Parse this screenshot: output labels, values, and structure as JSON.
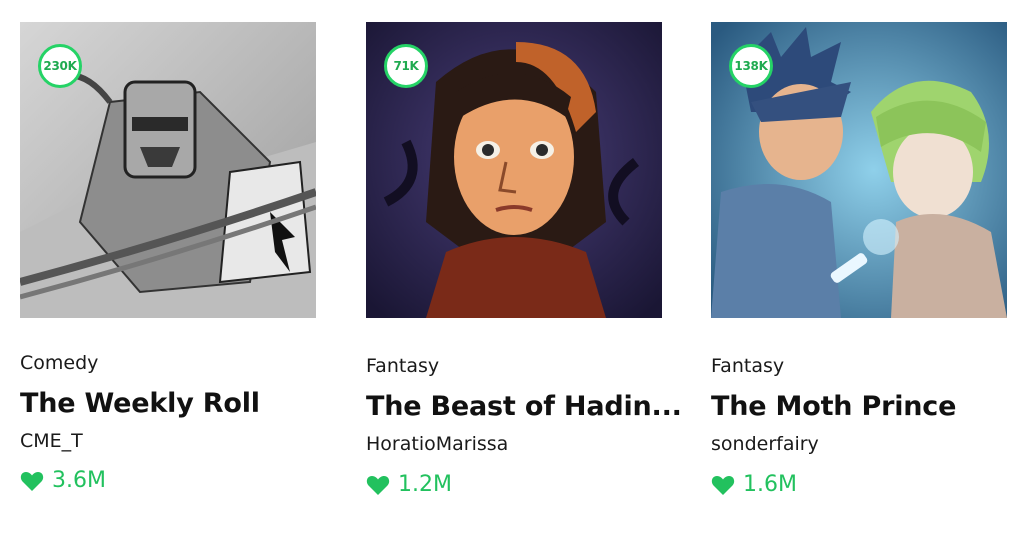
{
  "accent_color": "#25d366",
  "cards": [
    {
      "badge": "230K",
      "genre": "Comedy",
      "title": "The Weekly Roll",
      "author": "CME_T",
      "likes": "3.6M",
      "thumbnail_icon": "armored-knight-illustration"
    },
    {
      "badge": "71K",
      "genre": "Fantasy",
      "title": "The Beast of Hadin...",
      "author": "HoratioMarissa",
      "likes": "1.2M",
      "thumbnail_icon": "woman-portrait-illustration"
    },
    {
      "badge": "138K",
      "genre": "Fantasy",
      "title": "The Moth Prince",
      "author": "sonderfairy",
      "likes": "1.6M",
      "thumbnail_icon": "boy-and-elf-illustration"
    }
  ]
}
